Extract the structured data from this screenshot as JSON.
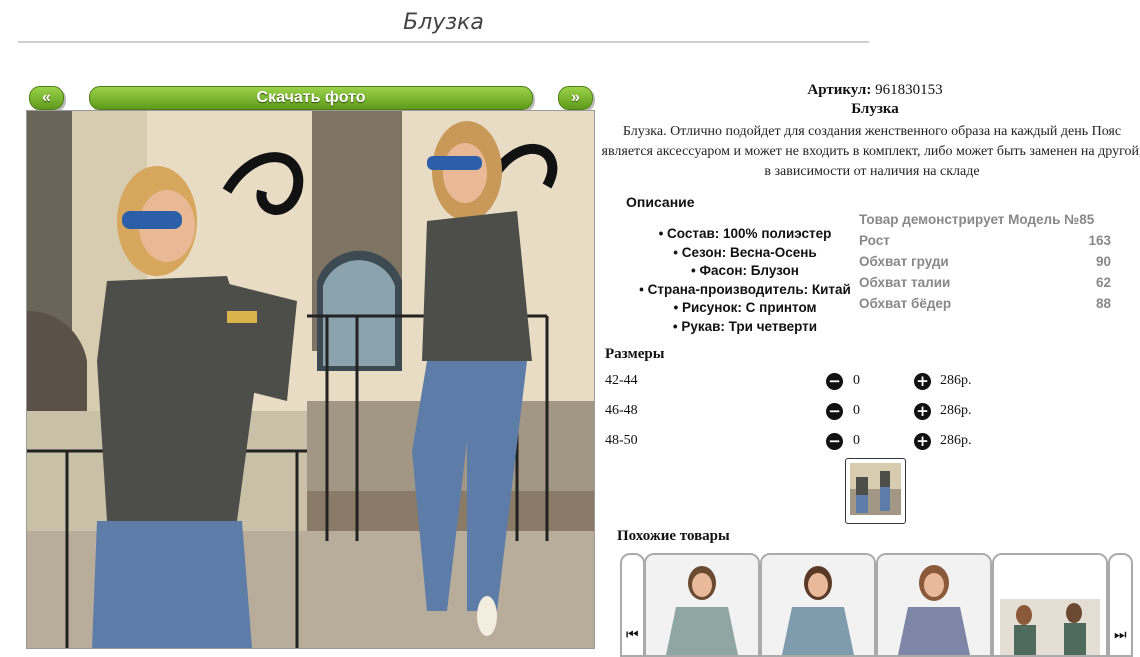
{
  "page": {
    "title": "Блузка"
  },
  "gallery": {
    "prev_label": "«",
    "next_label": "»",
    "download_label": "Скачать фото"
  },
  "product": {
    "article_label": "Артикул:",
    "article_value": "961830153",
    "name": "Блузка",
    "description": "Блузка. Отлично подойдет для создания женственного образа на каждый день Пояс является аксессуаром и может не входить в комплект, либо может быть заменен на другой, в зависимости от наличия на складе"
  },
  "specs": {
    "title": "Описание",
    "items": [
      "Состав: 100% полиэстер",
      "Сезон: Весна-Осень",
      "Фасон: Блузон",
      "Страна-производитель: Китай",
      "Рисунок: С принтом",
      "Рукав: Три четверти"
    ]
  },
  "model": {
    "title": "Товар демонстрирует Модель №85",
    "rows": [
      {
        "label": "Рост",
        "value": "163"
      },
      {
        "label": "Обхват груди",
        "value": "90"
      },
      {
        "label": "Обхват талии",
        "value": "62"
      },
      {
        "label": "Обхват бёдер",
        "value": "88"
      }
    ]
  },
  "sizes": {
    "title": "Размеры",
    "rows": [
      {
        "size": "42-44",
        "qty": "0",
        "price": "286р."
      },
      {
        "size": "46-48",
        "qty": "0",
        "price": "286р."
      },
      {
        "size": "48-50",
        "qty": "0",
        "price": "286р."
      }
    ]
  },
  "similar": {
    "title": "Похожие товары"
  },
  "colors": {
    "button_green": "#6aa822",
    "text_grey": "#888888"
  },
  "icons": {
    "minus": "minus-circle-icon",
    "plus": "plus-circle-icon",
    "carousel_prev": "skip-back-icon",
    "carousel_next": "skip-forward-icon"
  }
}
